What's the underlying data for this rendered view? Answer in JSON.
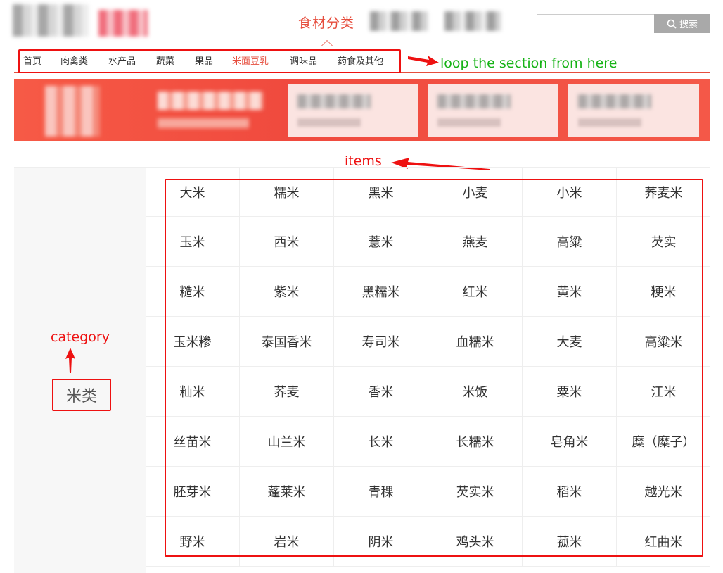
{
  "header": {
    "active_tab": "食材分类",
    "search": {
      "placeholder": "",
      "button_label": "搜索"
    }
  },
  "subnav": {
    "items": [
      {
        "label": "首页",
        "active": false
      },
      {
        "label": "肉禽类",
        "active": false
      },
      {
        "label": "水产品",
        "active": false
      },
      {
        "label": "蔬菜",
        "active": false
      },
      {
        "label": "果品",
        "active": false
      },
      {
        "label": "米面豆乳",
        "active": true
      },
      {
        "label": "调味品",
        "active": false
      },
      {
        "label": "药食及其他",
        "active": false
      }
    ]
  },
  "annotations": {
    "loop": "loop the section from here",
    "items": "items",
    "category": "category"
  },
  "category": {
    "label": "米类"
  },
  "items": [
    [
      "大米",
      "糯米",
      "黑米",
      "小麦",
      "小米",
      "荞麦米"
    ],
    [
      "玉米",
      "西米",
      "薏米",
      "燕麦",
      "高粱",
      "芡实"
    ],
    [
      "糙米",
      "紫米",
      "黑糯米",
      "红米",
      "黄米",
      "粳米"
    ],
    [
      "玉米糁",
      "泰国香米",
      "寿司米",
      "血糯米",
      "大麦",
      "高粱米"
    ],
    [
      "籼米",
      "荞麦",
      "香米",
      "米饭",
      "粟米",
      "江米"
    ],
    [
      "丝苗米",
      "山兰米",
      "长米",
      "长糯米",
      "皂角米",
      "糜（糜子）"
    ],
    [
      "胚芽米",
      "蓬莱米",
      "青稞",
      "芡实米",
      "稻米",
      "越光米"
    ],
    [
      "野米",
      "岩米",
      "阴米",
      "鸡头米",
      "菰米",
      "红曲米"
    ]
  ],
  "colors": {
    "accent": "#e64d3d",
    "annotation_red": "#e11111",
    "annotation_green": "#16b316"
  }
}
